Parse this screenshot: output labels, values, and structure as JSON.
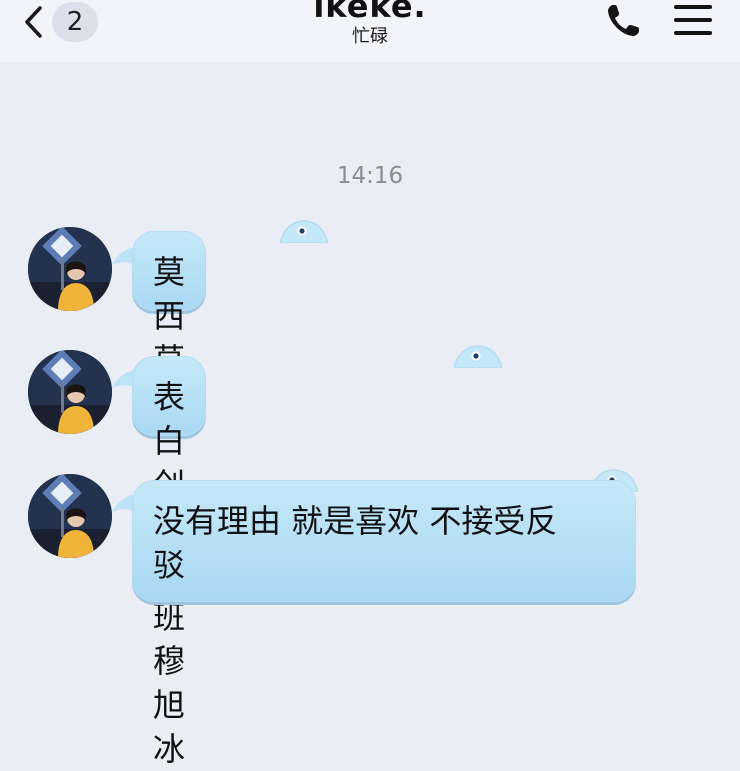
{
  "header": {
    "unread_count": "2",
    "title": "lkeke.",
    "status": "忙碌"
  },
  "timestamp": "14:16",
  "messages": [
    {
      "text": "莫西莫西"
    },
    {
      "text": "表白创新三班穆旭冰"
    },
    {
      "text": "没有理由 就是喜欢 不接受反\n驳"
    }
  ],
  "colors": {
    "bubble": "#b3def6",
    "background": "#ebedf5",
    "header": "#f3f4fa"
  }
}
